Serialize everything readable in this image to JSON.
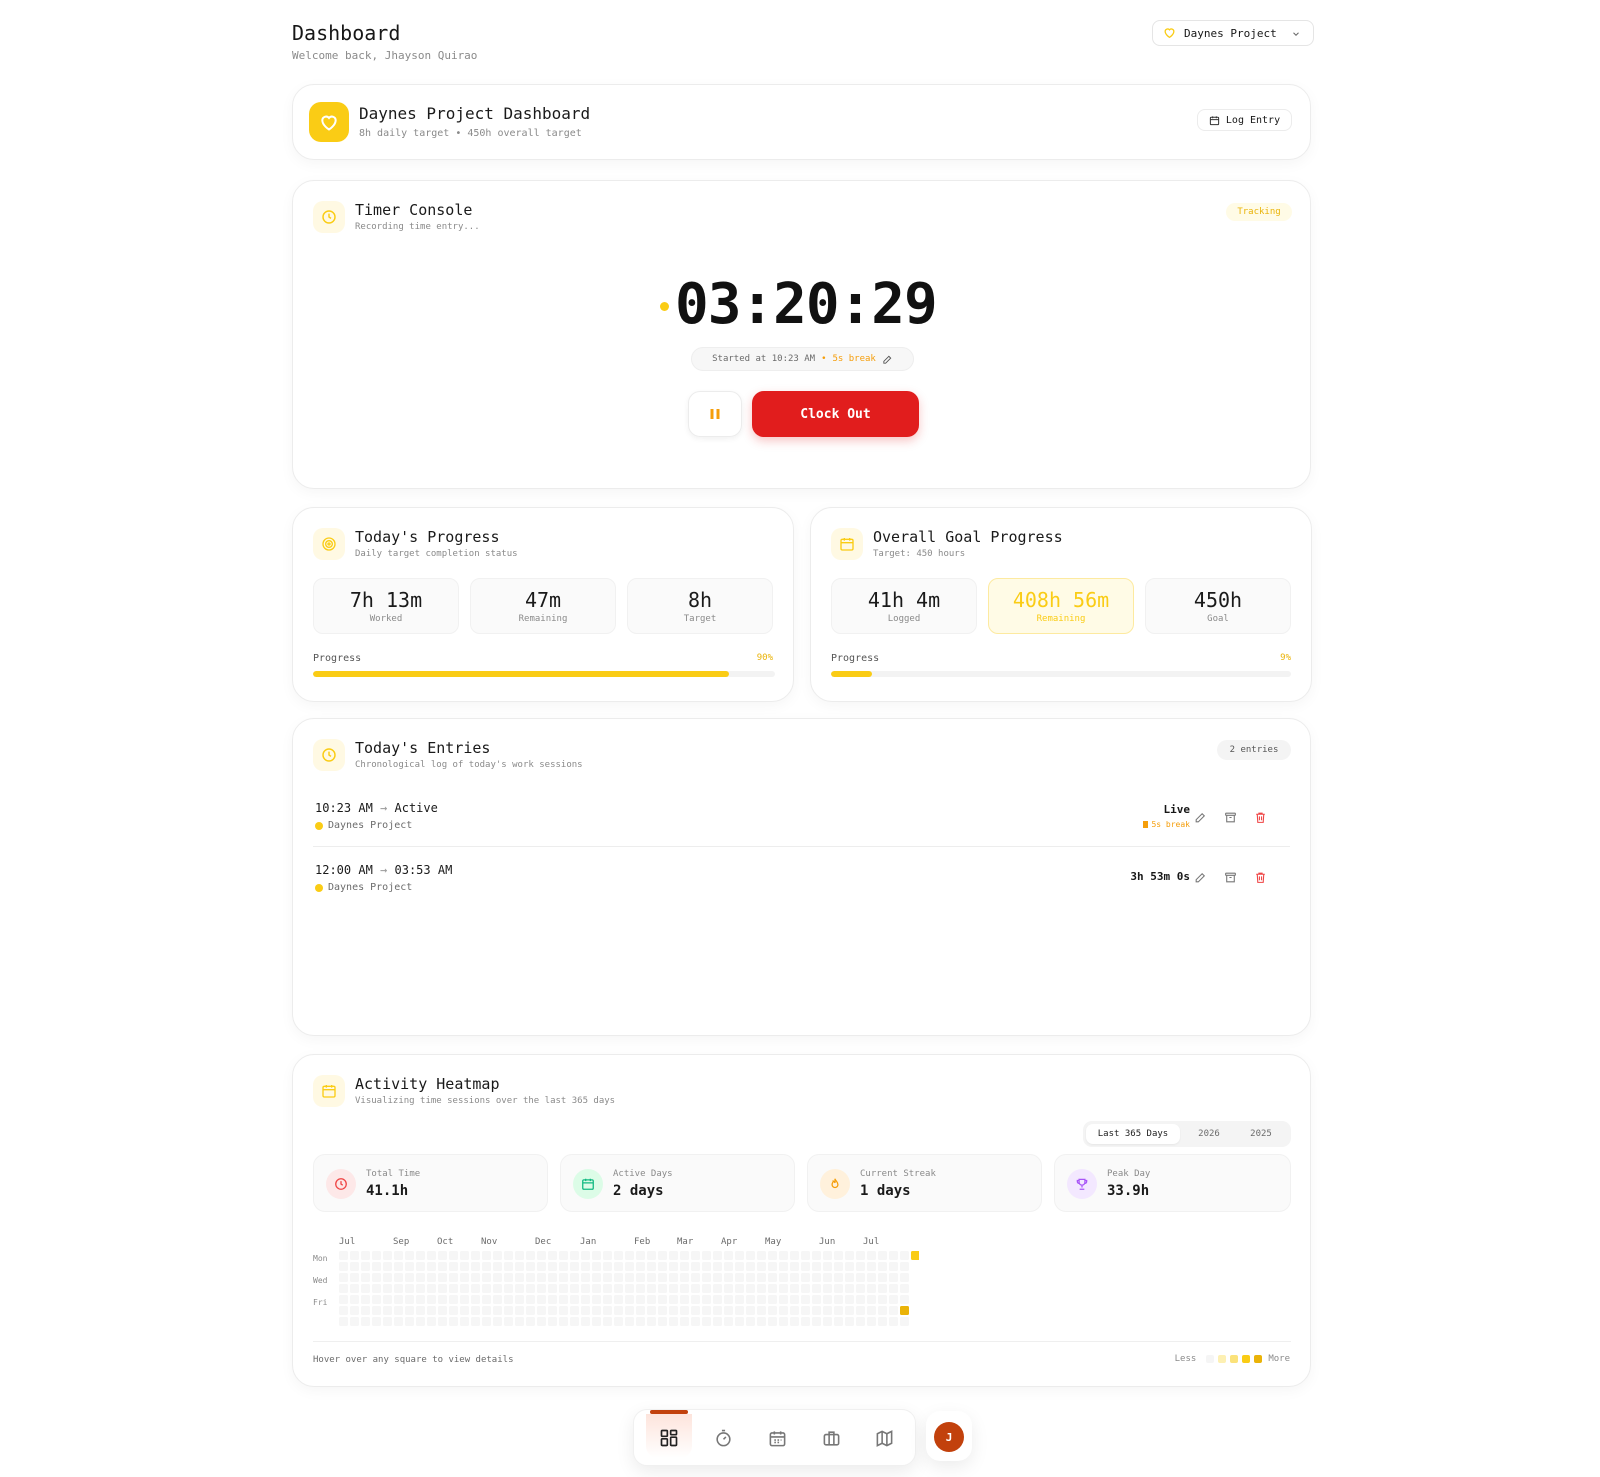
{
  "header": {
    "title": "Dashboard",
    "welcome": "Welcome back, Jhayson Quirao",
    "project_selector": "Daynes Project"
  },
  "project_banner": {
    "title": "Daynes Project Dashboard",
    "subtitle": "8h daily target • 450h overall target",
    "log_entry_label": "Log Entry"
  },
  "timer": {
    "title": "Timer Console",
    "subtitle": "Recording time entry...",
    "status": "Tracking",
    "time": "03:20:29",
    "started": "Started at 10:23 AM",
    "sep": "•",
    "break": "5s break",
    "clock_out_label": "Clock Out"
  },
  "today_progress": {
    "title": "Today's Progress",
    "subtitle": "Daily target completion status",
    "stats": [
      {
        "value": "7h 13m",
        "label": "Worked"
      },
      {
        "value": "47m",
        "label": "Remaining"
      },
      {
        "value": "8h",
        "label": "Target"
      }
    ],
    "progress_label": "Progress",
    "percent_text": "90%",
    "percent": 90
  },
  "overall_progress": {
    "title": "Overall Goal Progress",
    "subtitle": "Target: 450 hours",
    "stats": [
      {
        "value": "41h 4m",
        "label": "Logged"
      },
      {
        "value": "408h 56m",
        "label": "Remaining"
      },
      {
        "value": "450h",
        "label": "Goal"
      }
    ],
    "progress_label": "Progress",
    "percent_text": "9%",
    "percent": 9
  },
  "entries": {
    "title": "Today's Entries",
    "subtitle": "Chronological log of today's work sessions",
    "count": "2 entries",
    "items": [
      {
        "start": "10:23 AM",
        "arrow": "→",
        "end": "Active",
        "project": "Daynes Project",
        "duration": "Live",
        "break": "5s break"
      },
      {
        "start": "12:00 AM",
        "arrow": "→",
        "end": "03:53 AM",
        "project": "Daynes Project",
        "duration": "3h 53m 0s"
      }
    ]
  },
  "heatmap": {
    "title": "Activity Heatmap",
    "subtitle": "Visualizing time sessions over the last 365 days",
    "ranges": [
      "Last 365 Days",
      "2026",
      "2025"
    ],
    "stats": [
      {
        "label": "Total Time",
        "value": "41.1h",
        "icon": "clock-icon",
        "color": "#ef4444"
      },
      {
        "label": "Active Days",
        "value": "2 days",
        "icon": "calendar-icon",
        "color": "#10b981"
      },
      {
        "label": "Current Streak",
        "value": "1 days",
        "icon": "flame-icon",
        "color": "#f59e0b"
      },
      {
        "label": "Peak Day",
        "value": "33.9h",
        "icon": "trophy-icon",
        "color": "#a855f7"
      }
    ],
    "months": [
      "Jul",
      "Sep",
      "Oct",
      "Nov",
      "Dec",
      "Jan",
      "Feb",
      "Mar",
      "Apr",
      "May",
      "Jun",
      "Jul"
    ],
    "days": [
      "Mon",
      "Wed",
      "Fri"
    ],
    "hint": "Hover over any square to view details",
    "less": "Less",
    "more": "More"
  },
  "bottom_nav": {
    "items": [
      "dashboard-icon",
      "timer-icon",
      "calendar-icon",
      "briefcase-icon",
      "map-icon"
    ],
    "avatar": "J"
  },
  "colors": {
    "accent": "#facc15",
    "danger": "#e11d1d",
    "avatar": "#c2410c"
  }
}
